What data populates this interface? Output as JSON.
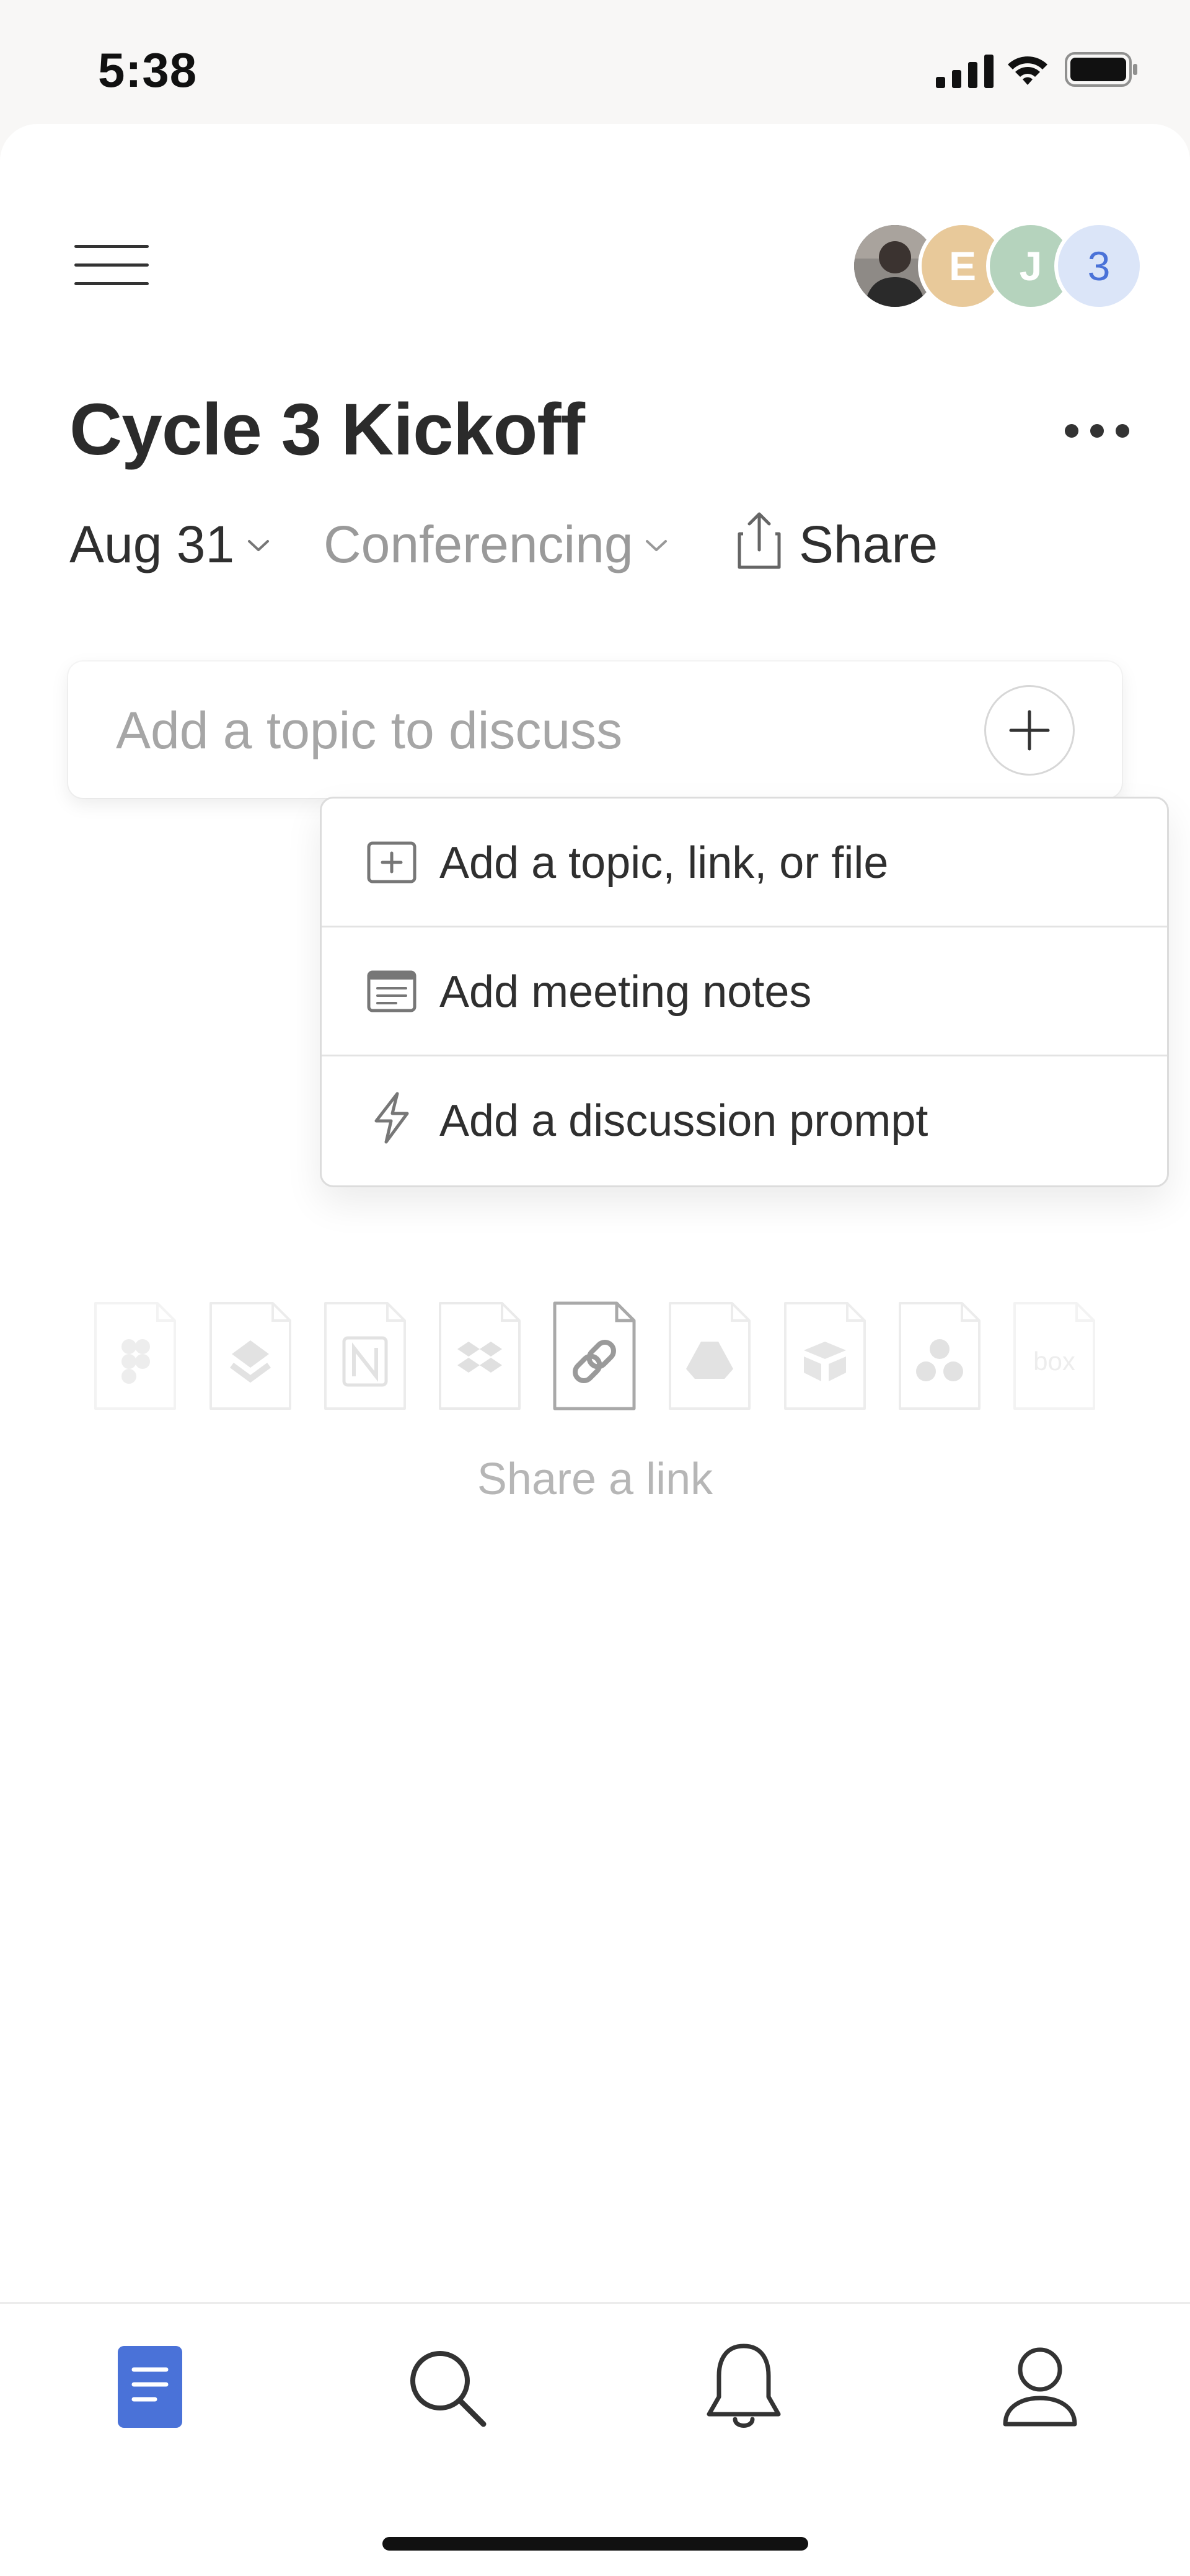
{
  "status_bar": {
    "time": "5:38"
  },
  "header": {
    "avatars": [
      {
        "type": "photo",
        "color": "#5a5f63"
      },
      {
        "type": "initial",
        "label": "E",
        "color": "#e8c99a"
      },
      {
        "type": "initial",
        "label": "J",
        "color": "#b5d3bd"
      },
      {
        "type": "count",
        "label": "3",
        "color": "#dbe5f8",
        "text_color": "#4a72d8"
      }
    ]
  },
  "meeting": {
    "title": "Cycle 3 Kickoff",
    "date": "Aug 31",
    "conferencing": "Conferencing",
    "share": "Share"
  },
  "topic_input": {
    "placeholder": "Add a topic to discuss"
  },
  "add_menu": {
    "items": [
      {
        "label": "Add a topic, link, or file",
        "icon": "plus-square-icon"
      },
      {
        "label": "Add meeting notes",
        "icon": "notes-icon"
      },
      {
        "label": "Add a discussion prompt",
        "icon": "lightning-icon"
      }
    ]
  },
  "integrations": {
    "tiles": [
      "figma-icon",
      "layers-icon",
      "notion-icon",
      "dropbox-icon",
      "link-icon",
      "google-drive-icon",
      "airtable-icon",
      "asana-icon",
      "box-icon"
    ],
    "selected": "link-icon",
    "label": "Share a link",
    "box_text": "box"
  },
  "tab_bar": {
    "tabs": [
      "document-icon",
      "search-icon",
      "bell-icon",
      "profile-icon"
    ],
    "active": "document-icon",
    "accent": "#4a72d8"
  }
}
